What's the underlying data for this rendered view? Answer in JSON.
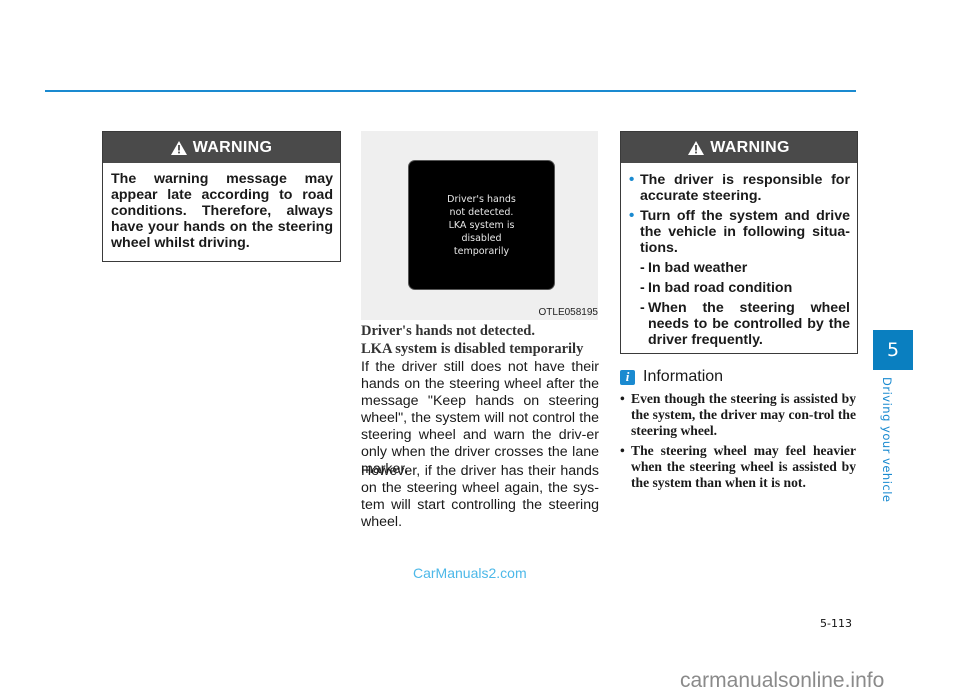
{
  "header": {
    "accent_color": "#1a8ad0"
  },
  "warning_left": {
    "title": "WARNING",
    "body": "The warning message may appear late according to road conditions. Therefore, always have your hands on the steering wheel whilst driving."
  },
  "figure": {
    "screen_text": "Driver's hands\nnot detected.\nLKA system is\ndisabled\ntemporarily",
    "code": "OTLE058195"
  },
  "section": {
    "heading_line1": "Driver's hands not detected.",
    "heading_line2": "LKA system is disabled temporarily",
    "paragraphs": [
      "If the driver still does not have their hands on the steering wheel after the message \"Keep hands on steering wheel\", the system will not control the steering wheel and warn the driv-er only when the driver crosses the lane marker.",
      "However, if the driver has their hands on the steering wheel again, the sys-tem will start controlling the steering wheel."
    ]
  },
  "warning_right": {
    "title": "WARNING",
    "bullets": [
      "The driver is responsible for accurate steering.",
      "Turn off the system and drive the vehicle in following situa-tions."
    ],
    "sub_items": [
      "In bad weather",
      "In bad road condition",
      "When the steering wheel needs to be controlled by the driver frequently."
    ]
  },
  "information": {
    "icon": "i",
    "title": "Information",
    "items": [
      "Even though the steering is assisted by the system, the driver may con-trol the steering wheel.",
      "The steering wheel may feel heavier when the steering wheel is assisted by the system than when it is not."
    ]
  },
  "chapter": {
    "number": "5",
    "label": "Driving your vehicle",
    "color": "#0a7fc0"
  },
  "footer": {
    "page_number": "5-113",
    "watermark_center": "CarManuals2.com",
    "watermark_corner": "carmanualsonline.info"
  }
}
